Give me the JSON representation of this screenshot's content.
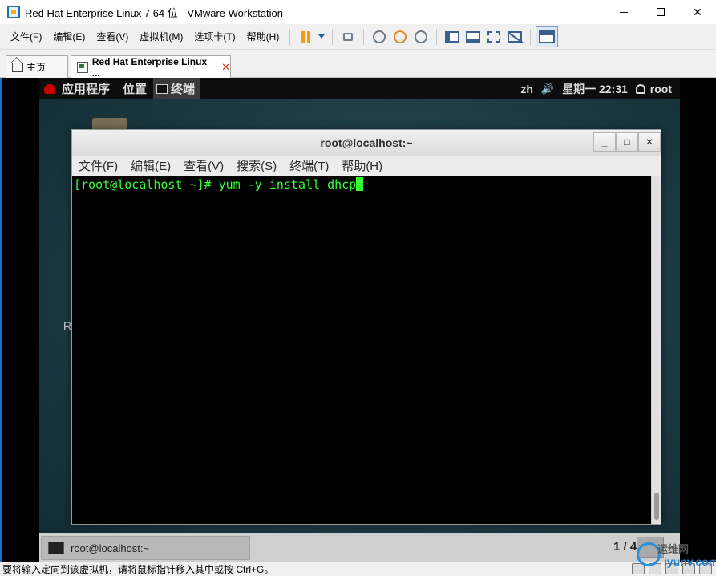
{
  "window": {
    "title": "Red Hat Enterprise Linux 7 64 位 - VMware Workstation",
    "minimize": "—",
    "close": "✕"
  },
  "menu": {
    "file": "文件(F)",
    "edit": "编辑(E)",
    "view": "查看(V)",
    "vm": "虚拟机(M)",
    "tabs": "选项卡(T)",
    "help": "帮助(H)"
  },
  "tabs": {
    "home": "主页",
    "vm": "Red Hat Enterprise Linux ...",
    "close": "✕"
  },
  "gnome": {
    "applications": "应用程序",
    "places": "位置",
    "terminal": "终端",
    "lang": "zh",
    "volume": "🔊",
    "clock": "星期一 22:31",
    "user": "root",
    "desktop_letter": "R"
  },
  "terminal": {
    "title": "root@localhost:~",
    "menu": {
      "file": "文件(F)",
      "edit": "编辑(E)",
      "view": "查看(V)",
      "search": "搜索(S)",
      "terminal": "终端(T)",
      "help": "帮助(H)"
    },
    "prompt": "[root@localhost ~]# yum -y install dhcp",
    "controls": {
      "minimize": "_",
      "maximize": "□",
      "close": "✕"
    }
  },
  "taskbar": {
    "item": "root@localhost:~",
    "workspace": "1 / 4"
  },
  "status": {
    "message": "要将输入定向到该虚拟机，请将鼠标指针移入其中或按 Ctrl+G。"
  },
  "watermark": {
    "text": "运维网",
    "url": "iyunv.com"
  },
  "colors": {
    "terminal_fg": "#33ff33",
    "terminal_bg": "#000000",
    "pause": "#f29b1d",
    "accent": "#1d6fc9"
  }
}
